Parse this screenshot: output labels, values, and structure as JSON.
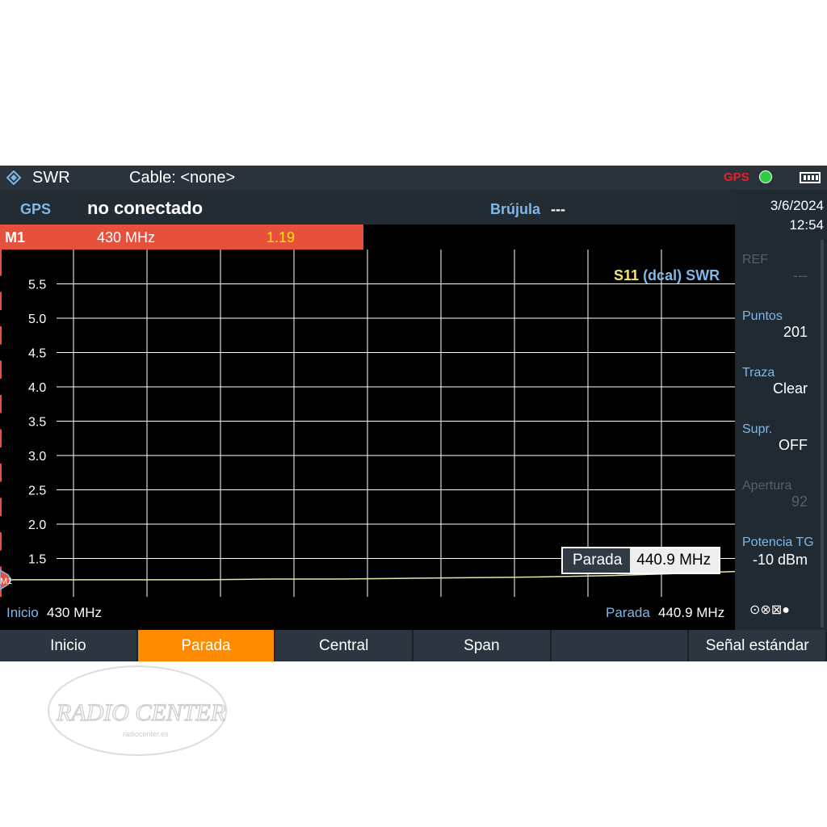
{
  "topbar": {
    "mode": "SWR",
    "cable": "Cable: <none>",
    "gps_badge": "GPS"
  },
  "info": {
    "gps_label": "GPS",
    "gps_value": "no conectado",
    "compass_label": "Brújula",
    "compass_value": "---"
  },
  "marker": {
    "id": "M1",
    "freq": "430 MHz",
    "value": "1.19"
  },
  "trace_label": {
    "s11": "S11",
    "dcal": "(dcal)",
    "swr": "SWR"
  },
  "side": {
    "date": "3/6/2024",
    "time": "12:54",
    "ref_label": "REF",
    "ref_value": "---",
    "points_label": "Puntos",
    "points_value": "201",
    "trace_label": "Traza",
    "trace_value": "Clear",
    "supr_label": "Supr.",
    "supr_value": "OFF",
    "aperture_label": "Apertura",
    "aperture_value": "92",
    "power_label": "Potencia TG",
    "power_value": "-10 dBm",
    "status_icons": "⊙⊗⊠●"
  },
  "axis": {
    "start_label": "Inicio",
    "start_value": "430 MHz",
    "stop_label": "Parada",
    "stop_value": "440.9 MHz"
  },
  "readout": {
    "label": "Parada",
    "value": "440.9 MHz"
  },
  "softkeys": [
    "Inicio",
    "Parada",
    "Central",
    "Span",
    "",
    "Señal estándar"
  ],
  "watermark": {
    "text": "RADIO CENTER",
    "url": "radiocenter.es"
  },
  "chart_data": {
    "type": "line",
    "x_range": [
      430,
      440.9
    ],
    "x_unit": "MHz",
    "ylim": [
      1.0,
      6.0
    ],
    "yticks": [
      1.5,
      2.0,
      2.5,
      3.0,
      3.5,
      4.0,
      4.5,
      5.0,
      5.5
    ],
    "ytick_labels": [
      "1.5",
      "2.0",
      "2.5",
      "3.0",
      "3.5",
      "4.0",
      "4.5",
      "5.0",
      "5.5"
    ],
    "series": [
      {
        "x": [
          430,
          431,
          432,
          433,
          434,
          435,
          436,
          437,
          438,
          439,
          440,
          440.9
        ],
        "values": [
          1.19,
          1.19,
          1.19,
          1.19,
          1.2,
          1.2,
          1.21,
          1.22,
          1.23,
          1.25,
          1.28,
          1.31
        ]
      }
    ],
    "grid": true,
    "colors": {
      "trace": "#e8e8a0",
      "grid": "#ffffff",
      "s11": "#f5e663",
      "swr": "#7fb8e8"
    }
  }
}
